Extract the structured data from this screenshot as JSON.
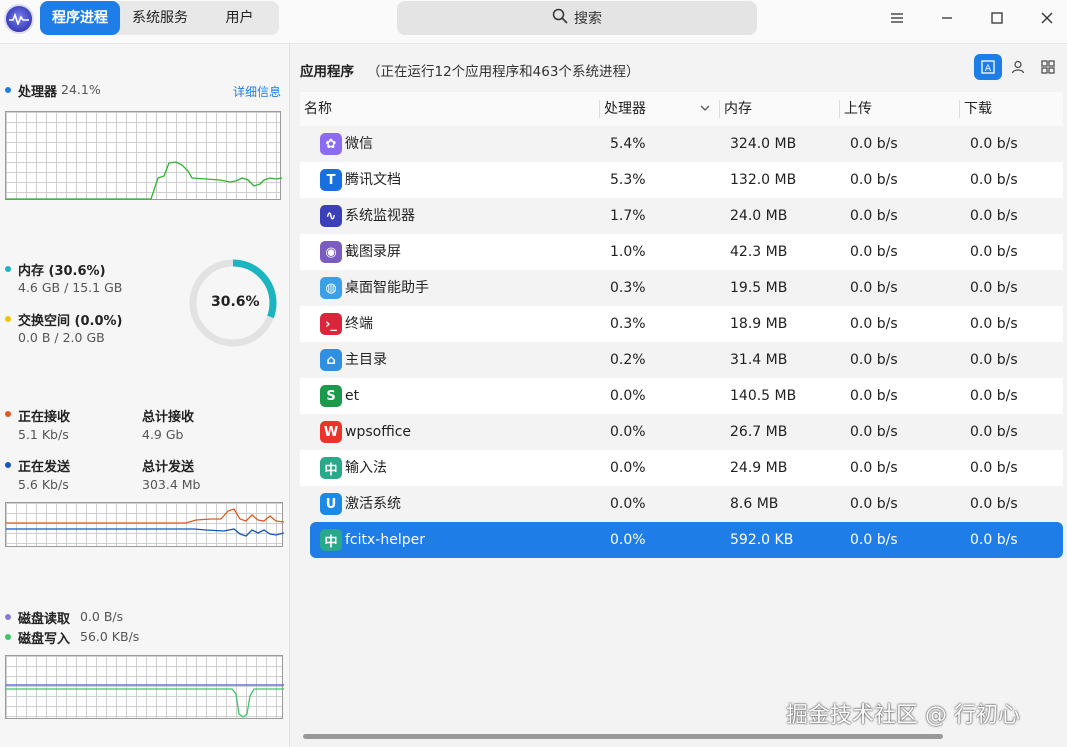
{
  "header": {
    "tabs": [
      {
        "label": "程序进程",
        "active": true
      },
      {
        "label": "系统服务",
        "active": false
      },
      {
        "label": "用户",
        "active": false
      }
    ],
    "search_placeholder": "搜索",
    "icons": {
      "logo": "system-monitor-logo",
      "search": "search-icon",
      "menu": "hamburger-menu-icon",
      "minimize": "minimize-icon",
      "maximize": "maximize-icon",
      "close": "close-icon"
    }
  },
  "sidebar": {
    "cpu": {
      "label": "处理器",
      "value": "24.1%",
      "details_link": "详细信息",
      "color": "#1e7de6",
      "line_color": "#2fb52f"
    },
    "memory": {
      "label": "内存 (30.6%)",
      "value": "4.6 GB / 15.1 GB",
      "color": "#1ab5c0",
      "percent_text": "30.6%",
      "percent": 30.6
    },
    "swap": {
      "label": "交换空间 (0.0%)",
      "value": "0.0 B / 2.0 GB",
      "color": "#f0c400"
    },
    "network": {
      "receiving_label": "正在接收",
      "receiving_value": "5.1 Kb/s",
      "receiving_color": "#e05a1e",
      "total_received_label": "总计接收",
      "total_received_value": "4.9 Gb",
      "sending_label": "正在发送",
      "sending_value": "5.6 Kb/s",
      "sending_color": "#1455c0",
      "total_sent_label": "总计发送",
      "total_sent_value": "303.4 Mb"
    },
    "disk": {
      "read_label": "磁盘读取",
      "read_value": "0.0 B/s",
      "read_color": "#8a7ad8",
      "write_label": "磁盘写入",
      "write_value": "56.0 KB/s",
      "write_color": "#3fc46a"
    }
  },
  "main": {
    "title": "应用程序",
    "subtitle": "（正在运行12个应用程序和463个系统进程）",
    "view_icons": [
      "application-view-icon",
      "user-view-icon",
      "all-processes-view-icon"
    ],
    "columns": [
      "名称",
      "处理器",
      "内存",
      "上传",
      "下载"
    ],
    "rows": [
      {
        "name": "微信",
        "cpu": "5.4%",
        "mem": "324.0 MB",
        "up": "0.0 b/s",
        "down": "0.0 b/s",
        "icon": "wechat-icon",
        "icon_color": "#8b6cf0",
        "glyph": "✿"
      },
      {
        "name": "腾讯文档",
        "cpu": "5.3%",
        "mem": "132.0 MB",
        "up": "0.0 b/s",
        "down": "0.0 b/s",
        "icon": "tencent-docs-icon",
        "icon_color": "#1a6fe0",
        "glyph": "T"
      },
      {
        "name": "系统监视器",
        "cpu": "1.7%",
        "mem": "24.0 MB",
        "up": "0.0 b/s",
        "down": "0.0 b/s",
        "icon": "system-monitor-icon",
        "icon_color": "#3b3fb8",
        "glyph": "∿"
      },
      {
        "name": "截图录屏",
        "cpu": "1.0%",
        "mem": "42.3 MB",
        "up": "0.0 b/s",
        "down": "0.0 b/s",
        "icon": "screenshot-icon",
        "icon_color": "#7a5cc0",
        "glyph": "◉"
      },
      {
        "name": "桌面智能助手",
        "cpu": "0.3%",
        "mem": "19.5 MB",
        "up": "0.0 b/s",
        "down": "0.0 b/s",
        "icon": "desktop-assistant-icon",
        "icon_color": "#3aa0e8",
        "glyph": "◍"
      },
      {
        "name": "终端",
        "cpu": "0.3%",
        "mem": "18.9 MB",
        "up": "0.0 b/s",
        "down": "0.0 b/s",
        "icon": "terminal-icon",
        "icon_color": "#d9263a",
        "glyph": "›_"
      },
      {
        "name": "主目录",
        "cpu": "0.2%",
        "mem": "31.4 MB",
        "up": "0.0 b/s",
        "down": "0.0 b/s",
        "icon": "home-folder-icon",
        "icon_color": "#2f8fe0",
        "glyph": "⌂"
      },
      {
        "name": "et",
        "cpu": "0.0%",
        "mem": "140.5 MB",
        "up": "0.0 b/s",
        "down": "0.0 b/s",
        "icon": "wps-spreadsheet-icon",
        "icon_color": "#1a9a4a",
        "glyph": "S"
      },
      {
        "name": "wpsoffice",
        "cpu": "0.0%",
        "mem": "26.7 MB",
        "up": "0.0 b/s",
        "down": "0.0 b/s",
        "icon": "wps-office-icon",
        "icon_color": "#e8342a",
        "glyph": "W"
      },
      {
        "name": "输入法",
        "cpu": "0.0%",
        "mem": "24.9 MB",
        "up": "0.0 b/s",
        "down": "0.0 b/s",
        "icon": "input-method-icon",
        "icon_color": "#2aa88a",
        "glyph": "中"
      },
      {
        "name": "激活系统",
        "cpu": "0.0%",
        "mem": "8.6 MB",
        "up": "0.0 b/s",
        "down": "0.0 b/s",
        "icon": "activation-icon",
        "icon_color": "#1a8ae6",
        "glyph": "U"
      },
      {
        "name": "fcitx-helper",
        "cpu": "0.0%",
        "mem": "592.0 KB",
        "up": "0.0 b/s",
        "down": "0.0 b/s",
        "icon": "fcitx-helper-icon",
        "icon_color": "#2aa88a",
        "glyph": "中",
        "selected": true
      }
    ]
  },
  "watermark": "掘金技术社区 @ 行初心"
}
